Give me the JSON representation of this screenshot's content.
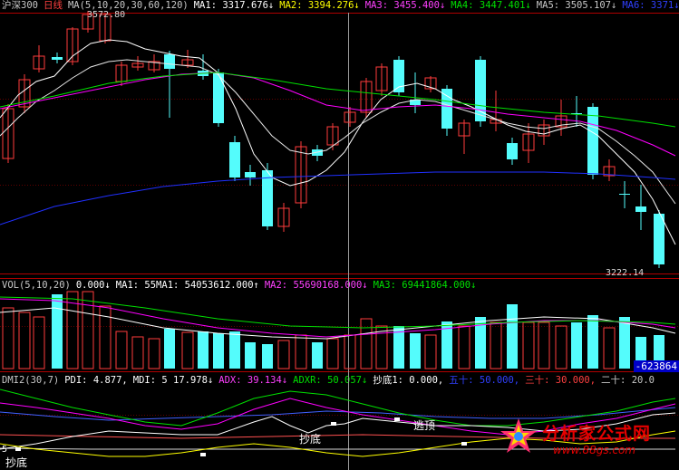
{
  "main_header": {
    "index": "沪深300",
    "period": "日线",
    "ma_def": "MA(5,10,20,30,60,120)",
    "ma1": "MA1: 3317.676↓",
    "ma2": "MA2: 3394.276↓",
    "ma3": "MA3: 3455.400↓",
    "ma4": "MA4: 3447.401↓",
    "ma5": "MA5: 3505.107↓",
    "ma6": "MA6: 3371↓"
  },
  "price_labels": {
    "high": "3572.80",
    "low": "3222.14"
  },
  "vol_header": {
    "def": "VOL(5,10,20)",
    "vol": "0.000↓",
    "ma1": "MA1: 55MA1: 54053612.000↑",
    "ma2": "MA2: 55690168.000↓",
    "ma3": "MA3: 69441864.000↓"
  },
  "vol_box": "-623864",
  "dmi_header": {
    "def": "DMI2(30,7)",
    "pdi": "PDI: 4.877,",
    "mdi": "MDI: 5 17.978↓",
    "adx": "ADX: 39.134↓",
    "adxr": "ADXR: 50.057↓",
    "chaodi": "抄底1: 0.000,",
    "wushi": "五十: 50.000,",
    "sanshi": "三十: 30.000,",
    "ershi": "二十: 20.0"
  },
  "dmi_annotations": {
    "chaodi": "抄底",
    "taoding": "逃顶",
    "chaodi_left": "抄底",
    "five": "5"
  },
  "logo": {
    "text": "分析家公式网",
    "url": "www.88gs.com"
  },
  "colors": {
    "up": "#ff3c3c",
    "down": "#54fcfc",
    "ma1": "#ffffff",
    "ma2": "#ffff00",
    "ma3": "#ff00ff",
    "ma4": "#00e000",
    "ma5": "#2030ff",
    "grid": "#b00000"
  }
}
